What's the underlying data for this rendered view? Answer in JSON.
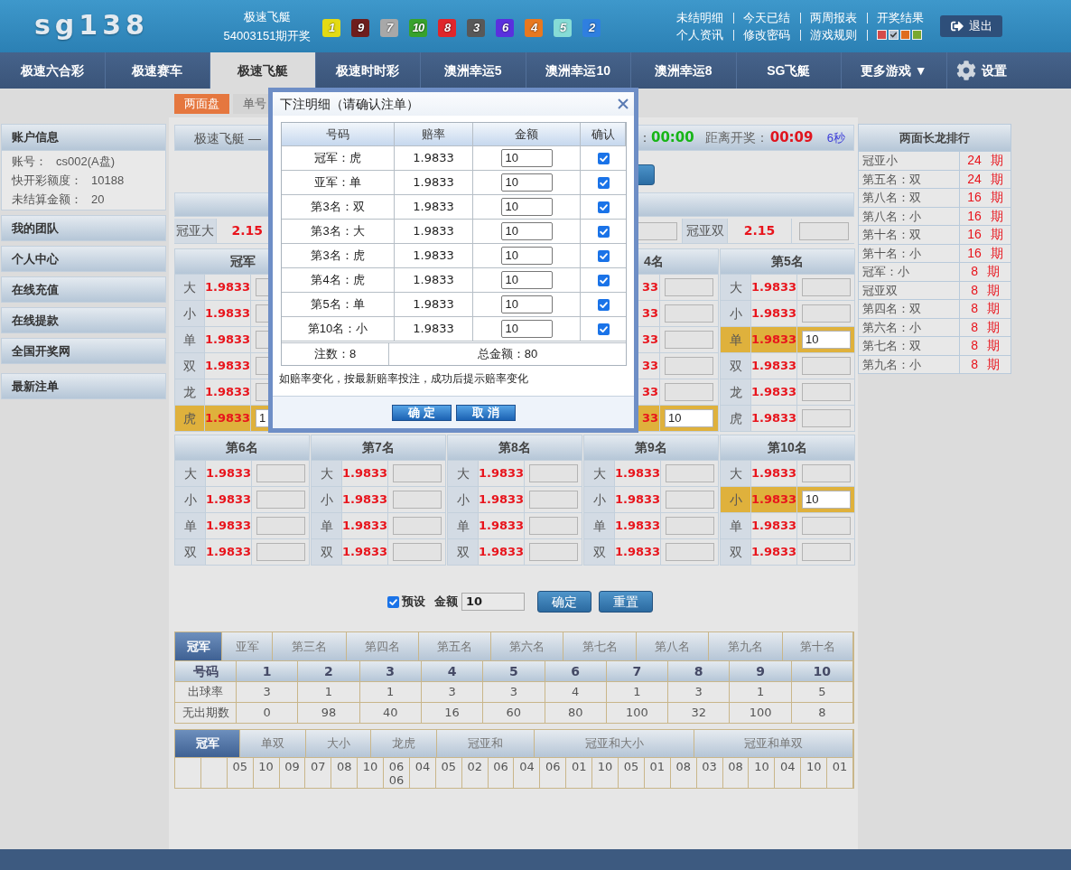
{
  "header": {
    "logo": "sg138",
    "game": "极速飞艇",
    "draw": "54003151期开奖",
    "balls": [
      {
        "number": "1",
        "color": "#e3da14"
      },
      {
        "number": "9",
        "color": "#6e1d1d"
      },
      {
        "number": "7",
        "color": "#a8a8a8"
      },
      {
        "number": "10",
        "color": "#38a22b"
      },
      {
        "number": "8",
        "color": "#e0262b"
      },
      {
        "number": "3",
        "color": "#585858"
      },
      {
        "number": "6",
        "color": "#5a30de"
      },
      {
        "number": "4",
        "color": "#e8781f"
      },
      {
        "number": "5",
        "color": "#86dcd6"
      },
      {
        "number": "2",
        "color": "#2f7fe0"
      }
    ],
    "links": [
      [
        "未结明细",
        "今天已结",
        "两周报表",
        "开奖结果"
      ],
      [
        "个人资讯",
        "修改密码",
        "游戏规则"
      ]
    ],
    "themes": [
      {
        "color": "#d44a4a",
        "selected": false
      },
      {
        "color": "#b9c4d2",
        "selected": true
      },
      {
        "color": "#df6c1c",
        "selected": false
      },
      {
        "color": "#79a830",
        "selected": false
      }
    ],
    "logout": "退出"
  },
  "nav": {
    "items": [
      {
        "label": "极速六合彩",
        "selected": false
      },
      {
        "label": "极速赛车",
        "selected": false
      },
      {
        "label": "极速飞艇",
        "selected": true
      },
      {
        "label": "极速时时彩",
        "selected": false
      },
      {
        "label": "澳洲幸运5",
        "selected": false
      },
      {
        "label": "澳洲幸运10",
        "selected": false
      },
      {
        "label": "澳洲幸运8",
        "selected": false
      },
      {
        "label": "SG飞艇",
        "selected": false
      },
      {
        "label": "更多游戏 ▼",
        "selected": false
      }
    ],
    "settings": "设置"
  },
  "sidebar": {
    "account": {
      "title": "账户信息",
      "fields": [
        {
          "label": "账号：",
          "value": "cs002(A盘)"
        },
        {
          "label": "快开彩额度：",
          "value": "10188"
        },
        {
          "label": "未结算金额：",
          "value": "20"
        }
      ]
    },
    "menu": [
      "我的团队",
      "个人中心",
      "在线充值",
      "在线提款",
      "全国开奖网",
      "最新注单"
    ]
  },
  "board": {
    "tabs": [
      {
        "label": "两面盘",
        "selected": true
      },
      {
        "label": "单号",
        "selected": false
      }
    ],
    "title": "极速飞艇 —",
    "timer": {
      "colon": "：",
      "close_time": "00:00",
      "draw_label": "距离开奖：",
      "draw_time": "00:09",
      "countdown": "6秒"
    },
    "combo": [
      {
        "name": "冠亚大",
        "odds": "2.15"
      },
      {
        "name": "冠亚双",
        "odds": "2.15"
      }
    ],
    "top_columns": [
      {
        "kind": "left_part",
        "title": "冠军",
        "rows": [
          {
            "name": "大",
            "odds": "1.9833",
            "selected": false
          },
          {
            "name": "小",
            "odds": "1.9833",
            "selected": false
          },
          {
            "name": "单",
            "odds": "1.9833",
            "selected": false
          },
          {
            "name": "双",
            "odds": "1.9833",
            "selected": false
          },
          {
            "name": "龙",
            "odds": "1.9833",
            "selected": false
          },
          {
            "name": "虎",
            "odds": "1.9833",
            "selected": true,
            "value": "1"
          }
        ]
      },
      {
        "kind": "right_part",
        "title": "4名",
        "rows": [
          {
            "odds": "33",
            "selected": false
          },
          {
            "odds": "33",
            "selected": false
          },
          {
            "odds": "33",
            "selected": false
          },
          {
            "odds": "33",
            "selected": false
          },
          {
            "odds": "33",
            "selected": false
          },
          {
            "odds": "33",
            "selected": true,
            "value": "10"
          }
        ]
      },
      {
        "kind": "full",
        "title": "第5名",
        "rows": [
          {
            "name": "大",
            "odds": "1.9833",
            "selected": false
          },
          {
            "name": "小",
            "odds": "1.9833",
            "selected": false
          },
          {
            "name": "单",
            "odds": "1.9833",
            "selected": true,
            "value": "10"
          },
          {
            "name": "双",
            "odds": "1.9833",
            "selected": false
          },
          {
            "name": "龙",
            "odds": "1.9833",
            "selected": false
          },
          {
            "name": "虎",
            "odds": "1.9833",
            "selected": false
          }
        ]
      }
    ],
    "bottom_columns": [
      {
        "kind": "full",
        "title": "第6名",
        "rows": [
          {
            "name": "大",
            "odds": "1.9833",
            "selected": false
          },
          {
            "name": "小",
            "odds": "1.9833",
            "selected": false
          },
          {
            "name": "单",
            "odds": "1.9833",
            "selected": false
          },
          {
            "name": "双",
            "odds": "1.9833",
            "selected": false
          }
        ]
      },
      {
        "kind": "full",
        "title": "第7名",
        "rows": [
          {
            "name": "大",
            "odds": "1.9833",
            "selected": false
          },
          {
            "name": "小",
            "odds": "1.9833",
            "selected": false
          },
          {
            "name": "单",
            "odds": "1.9833",
            "selected": false
          },
          {
            "name": "双",
            "odds": "1.9833",
            "selected": false
          }
        ]
      },
      {
        "kind": "full",
        "title": "第8名",
        "rows": [
          {
            "name": "大",
            "odds": "1.9833",
            "selected": false
          },
          {
            "name": "小",
            "odds": "1.9833",
            "selected": false
          },
          {
            "name": "单",
            "odds": "1.9833",
            "selected": false
          },
          {
            "name": "双",
            "odds": "1.9833",
            "selected": false
          }
        ]
      },
      {
        "kind": "full",
        "title": "第9名",
        "rows": [
          {
            "name": "大",
            "odds": "1.9833",
            "selected": false
          },
          {
            "name": "小",
            "odds": "1.9833",
            "selected": false
          },
          {
            "name": "单",
            "odds": "1.9833",
            "selected": false
          },
          {
            "name": "双",
            "odds": "1.9833",
            "selected": false
          }
        ]
      },
      {
        "kind": "full",
        "title": "第10名",
        "rows": [
          {
            "name": "大",
            "odds": "1.9833",
            "selected": false
          },
          {
            "name": "小",
            "odds": "1.9833",
            "selected": true,
            "value": "10"
          },
          {
            "name": "单",
            "odds": "1.9833",
            "selected": false
          },
          {
            "name": "双",
            "odds": "1.9833",
            "selected": false
          }
        ]
      }
    ]
  },
  "preset": {
    "checked": true,
    "label": "预设",
    "amount_label": "金额",
    "amount": "10",
    "buttons": [
      "确定",
      "重置"
    ]
  },
  "stats": {
    "tabs": [
      {
        "label": "冠军",
        "selected": true
      },
      {
        "label": "亚军",
        "selected": false
      },
      {
        "label": "第三名",
        "selected": false
      },
      {
        "label": "第四名",
        "selected": false
      },
      {
        "label": "第五名",
        "selected": false
      },
      {
        "label": "第六名",
        "selected": false
      },
      {
        "label": "第七名",
        "selected": false
      },
      {
        "label": "第八名",
        "selected": false
      },
      {
        "label": "第九名",
        "selected": false
      },
      {
        "label": "第十名",
        "selected": false
      }
    ],
    "header": "号码",
    "numbers": [
      "1",
      "2",
      "3",
      "4",
      "5",
      "6",
      "7",
      "8",
      "9",
      "10"
    ],
    "rows": [
      {
        "label": "出球率",
        "values": [
          "3",
          "1",
          "1",
          "3",
          "3",
          "4",
          "1",
          "3",
          "1",
          "5"
        ]
      },
      {
        "label": "无出期数",
        "values": [
          "0",
          "98",
          "40",
          "16",
          "60",
          "80",
          "100",
          "32",
          "100",
          "8"
        ]
      }
    ]
  },
  "trend": {
    "tabs": [
      {
        "label": "冠军",
        "selected": true
      },
      {
        "label": "单双",
        "selected": false
      },
      {
        "label": "大小",
        "selected": false
      },
      {
        "label": "龙虎",
        "selected": false
      },
      {
        "label": "冠亚和",
        "selected": false
      },
      {
        "label": "冠亚和大小",
        "selected": false
      },
      {
        "label": "冠亚和单双",
        "selected": false
      }
    ],
    "cells": [
      {
        "kind": "blank"
      },
      {
        "kind": "blank"
      },
      {
        "kind": "value",
        "values": [
          "05"
        ]
      },
      {
        "kind": "value",
        "values": [
          "10"
        ]
      },
      {
        "kind": "value",
        "values": [
          "09"
        ]
      },
      {
        "kind": "value",
        "values": [
          "07"
        ]
      },
      {
        "kind": "value",
        "values": [
          "08"
        ]
      },
      {
        "kind": "value",
        "values": [
          "10"
        ]
      },
      {
        "kind": "value",
        "values": [
          "06",
          "06"
        ]
      },
      {
        "kind": "value",
        "values": [
          "04"
        ]
      },
      {
        "kind": "value",
        "values": [
          "05"
        ]
      },
      {
        "kind": "value",
        "values": [
          "02"
        ]
      },
      {
        "kind": "value",
        "values": [
          "06"
        ]
      },
      {
        "kind": "value",
        "values": [
          "04"
        ]
      },
      {
        "kind": "value",
        "values": [
          "06"
        ]
      },
      {
        "kind": "value",
        "values": [
          "01"
        ]
      },
      {
        "kind": "value",
        "values": [
          "10"
        ]
      },
      {
        "kind": "value",
        "values": [
          "05"
        ]
      },
      {
        "kind": "value",
        "values": [
          "01"
        ]
      },
      {
        "kind": "value",
        "values": [
          "08"
        ]
      },
      {
        "kind": "value",
        "values": [
          "03"
        ]
      },
      {
        "kind": "value",
        "values": [
          "08"
        ]
      },
      {
        "kind": "value",
        "values": [
          "10"
        ]
      },
      {
        "kind": "value",
        "values": [
          "04"
        ]
      },
      {
        "kind": "value",
        "values": [
          "10"
        ]
      },
      {
        "kind": "value",
        "values": [
          "01"
        ]
      }
    ]
  },
  "ranking": {
    "title": "两面长龙排行",
    "rows": [
      {
        "name": "冠亚小",
        "streak": "24 期"
      },
      {
        "name": "第五名：双",
        "streak": "24 期"
      },
      {
        "name": "第八名：双",
        "streak": "16 期"
      },
      {
        "name": "第八名：小",
        "streak": "16 期"
      },
      {
        "name": "第十名：双",
        "streak": "16 期"
      },
      {
        "name": "第十名：小",
        "streak": "16 期"
      },
      {
        "name": "冠军：小",
        "streak": "8 期"
      },
      {
        "name": "冠亚双",
        "streak": "8 期"
      },
      {
        "name": "第四名：双",
        "streak": "8 期"
      },
      {
        "name": "第六名：小",
        "streak": "8 期"
      },
      {
        "name": "第七名：双",
        "streak": "8 期"
      },
      {
        "name": "第九名：小",
        "streak": "8 期"
      }
    ]
  },
  "modal": {
    "title": "下注明细（请确认注单）",
    "columns": [
      "号码",
      "赔率",
      "金额",
      "确认"
    ],
    "rows": [
      {
        "item": "冠军：虎",
        "odds": "1.9833",
        "amount": "10",
        "checked": true
      },
      {
        "item": "亚军：单",
        "odds": "1.9833",
        "amount": "10",
        "checked": true
      },
      {
        "item": "第3名：双",
        "odds": "1.9833",
        "amount": "10",
        "checked": true
      },
      {
        "item": "第3名：大",
        "odds": "1.9833",
        "amount": "10",
        "checked": true
      },
      {
        "item": "第3名：虎",
        "odds": "1.9833",
        "amount": "10",
        "checked": true
      },
      {
        "item": "第4名：虎",
        "odds": "1.9833",
        "amount": "10",
        "checked": true
      },
      {
        "item": "第5名：单",
        "odds": "1.9833",
        "amount": "10",
        "checked": true
      },
      {
        "item": "第10名：小",
        "odds": "1.9833",
        "amount": "10",
        "checked": true
      }
    ],
    "count": "注数：8",
    "total": "总金额：80",
    "note": "如赔率变化，按最新赔率投注，成功后提示赔率变化",
    "buttons": [
      "确定",
      "取消"
    ]
  }
}
